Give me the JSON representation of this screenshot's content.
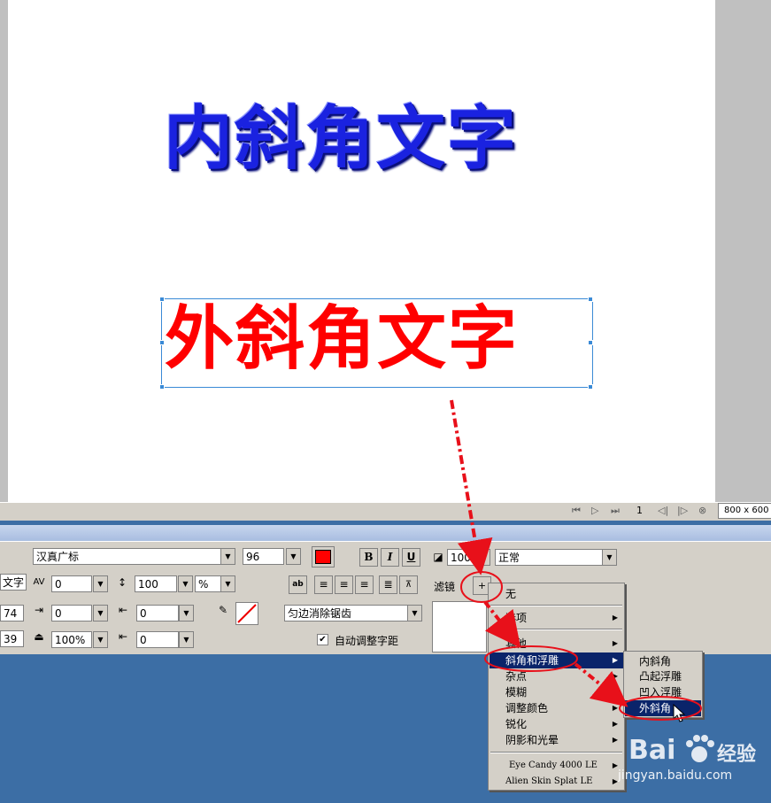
{
  "canvas": {
    "inner_bevel_text": "内斜角文字",
    "outer_bevel_text": "外斜角文字"
  },
  "statusbar": {
    "frame_number": "1",
    "canvas_size": "800 x 600"
  },
  "text_properties": {
    "text_label": "文字",
    "font_name": "汉真广标",
    "font_size": "96",
    "text_color": "#ff0000",
    "bold_label": "B",
    "italic_label": "I",
    "underline_label": "U",
    "kerning_value": "0",
    "leading_value": "100",
    "leading_unit": "%",
    "left_value_1": "74",
    "left_value_2": "39",
    "indent_value": "0",
    "space_before_value": "0",
    "space_after_value": "0",
    "horizontal_scale_value": "100%",
    "baseline_shift_value": "0",
    "antialias_mode": "匀边消除锯齿",
    "auto_kern_label": "自动调整字距",
    "auto_kern_checked": true
  },
  "object_properties": {
    "opacity_value": "100",
    "blend_mode": "正常",
    "filters_label": "滤镜",
    "add_filter_button": "+"
  },
  "filter_menu": {
    "items": [
      {
        "label": "无",
        "has_submenu": false
      },
      {
        "label": "选项",
        "has_submenu": true
      },
      {
        "label": "其他",
        "has_submenu": true
      },
      {
        "label": "斜角和浮雕",
        "has_submenu": true,
        "highlighted": true
      },
      {
        "label": "杂点",
        "has_submenu": true
      },
      {
        "label": "模糊",
        "has_submenu": true
      },
      {
        "label": "调整颜色",
        "has_submenu": true
      },
      {
        "label": "锐化",
        "has_submenu": true
      },
      {
        "label": "阴影和光晕",
        "has_submenu": true
      },
      {
        "label": "Eye Candy 4000 LE",
        "has_submenu": true
      },
      {
        "label": "Alien Skin Splat LE",
        "has_submenu": true
      }
    ]
  },
  "bevel_submenu": {
    "items": [
      {
        "label": "内斜角"
      },
      {
        "label": "凸起浮雕"
      },
      {
        "label": "凹入浮雕"
      },
      {
        "label": "外斜角",
        "highlighted": true
      }
    ]
  },
  "watermark": {
    "logo_text": "Bai",
    "logo_suffix": "经验",
    "url": "jingyan.baidu.com"
  },
  "colors": {
    "annotation_red": "#e8101a",
    "menu_highlight": "#0a246a",
    "inner_text_blue": "#1a22e0"
  }
}
